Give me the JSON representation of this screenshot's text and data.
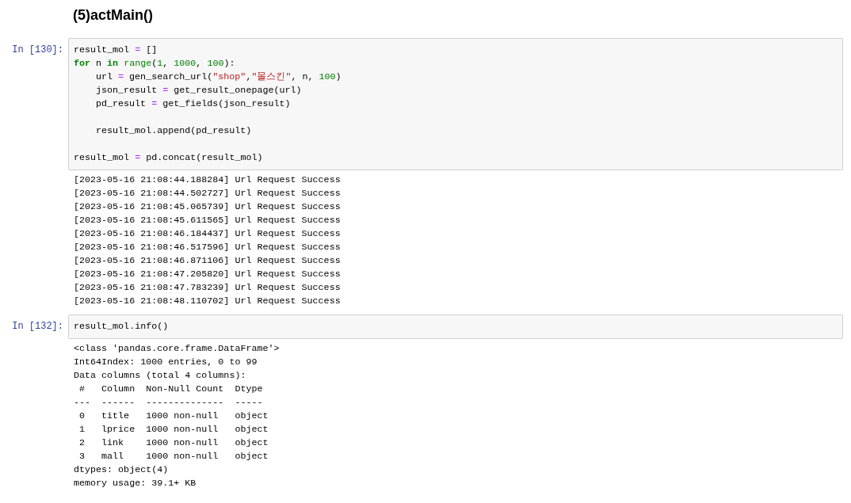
{
  "cells": [
    {
      "kind": "markdown",
      "heading": "(5)actMain()"
    },
    {
      "kind": "code",
      "prompt": "In [130]:",
      "lines": [
        {
          "kind": "code",
          "indented": false,
          "tokens": [
            {
              "kind": "plain",
              "text": "result_mol "
            },
            {
              "kind": "op",
              "text": "="
            },
            {
              "kind": "plain",
              "text": " []"
            }
          ]
        },
        {
          "kind": "code",
          "indented": false,
          "tokens": [
            {
              "kind": "keyword",
              "text": "for"
            },
            {
              "kind": "plain",
              "text": " n "
            },
            {
              "kind": "keyword",
              "text": "in "
            },
            {
              "kind": "builtin",
              "text": "range"
            },
            {
              "kind": "plain",
              "text": "("
            },
            {
              "kind": "number",
              "text": "1"
            },
            {
              "kind": "plain",
              "text": ", "
            },
            {
              "kind": "number",
              "text": "1000"
            },
            {
              "kind": "plain",
              "text": ", "
            },
            {
              "kind": "number",
              "text": "100"
            },
            {
              "kind": "plain",
              "text": "):"
            }
          ]
        },
        {
          "kind": "code",
          "indented": true,
          "tokens": [
            {
              "kind": "plain",
              "text": "url "
            },
            {
              "kind": "op",
              "text": "="
            },
            {
              "kind": "plain",
              "text": " gen_search_url("
            },
            {
              "kind": "string",
              "text": "\"shop\""
            },
            {
              "kind": "plain",
              "text": ","
            },
            {
              "kind": "string",
              "text": "\"몰스킨\""
            },
            {
              "kind": "plain",
              "text": ", n, "
            },
            {
              "kind": "number",
              "text": "100"
            },
            {
              "kind": "plain",
              "text": ")"
            }
          ]
        },
        {
          "kind": "code",
          "indented": true,
          "tokens": [
            {
              "kind": "plain",
              "text": "json_result "
            },
            {
              "kind": "op",
              "text": "="
            },
            {
              "kind": "plain",
              "text": " get_result_onepage(url)"
            }
          ]
        },
        {
          "kind": "code",
          "indented": true,
          "tokens": [
            {
              "kind": "plain",
              "text": "pd_result "
            },
            {
              "kind": "op",
              "text": "="
            },
            {
              "kind": "plain",
              "text": " get_fields(json_result)"
            }
          ]
        },
        {
          "kind": "blank"
        },
        {
          "kind": "code",
          "indented": true,
          "tokens": [
            {
              "kind": "plain",
              "text": "result_mol.append(pd_result)"
            }
          ]
        },
        {
          "kind": "blank"
        },
        {
          "kind": "code",
          "indented": false,
          "tokens": [
            {
              "kind": "plain",
              "text": "result_mol "
            },
            {
              "kind": "op",
              "text": "="
            },
            {
              "kind": "plain",
              "text": " pd.concat(result_mol)"
            }
          ]
        }
      ],
      "output": [
        "[2023-05-16 21:08:44.188284] Url Request Success",
        "[2023-05-16 21:08:44.502727] Url Request Success",
        "[2023-05-16 21:08:45.065739] Url Request Success",
        "[2023-05-16 21:08:45.611565] Url Request Success",
        "[2023-05-16 21:08:46.184437] Url Request Success",
        "[2023-05-16 21:08:46.517596] Url Request Success",
        "[2023-05-16 21:08:46.871106] Url Request Success",
        "[2023-05-16 21:08:47.205820] Url Request Success",
        "[2023-05-16 21:08:47.783239] Url Request Success",
        "[2023-05-16 21:08:48.110702] Url Request Success"
      ]
    },
    {
      "kind": "code",
      "prompt": "In [132]:",
      "lines": [
        {
          "kind": "code",
          "indented": false,
          "tokens": [
            {
              "kind": "plain",
              "text": "result_mol.info()"
            }
          ]
        }
      ],
      "output": [
        "<class 'pandas.core.frame.DataFrame'>",
        "Int64Index: 1000 entries, 0 to 99",
        "Data columns (total 4 columns):",
        " #   Column  Non-Null Count  Dtype ",
        "---  ------  --------------  ----- ",
        " 0   title   1000 non-null   object",
        " 1   lprice  1000 non-null   object",
        " 2   link    1000 non-null   object",
        " 3   mall    1000 non-null   object",
        "dtypes: object(4)",
        "memory usage: 39.1+ KB"
      ]
    }
  ]
}
